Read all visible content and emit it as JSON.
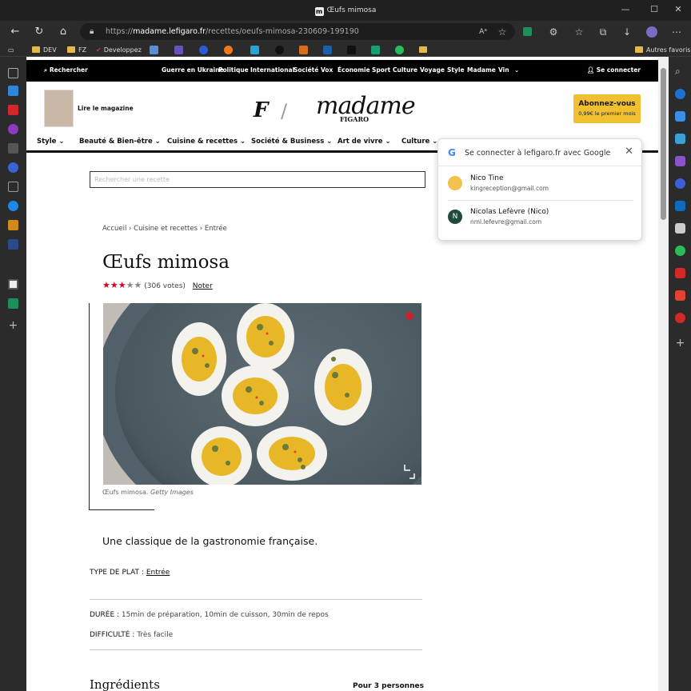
{
  "window": {
    "title": "Œufs mimosa",
    "logo_letter": "m"
  },
  "address": {
    "scheme": "https://",
    "host": "madame.lefigaro.fr",
    "path": "/recettes/oeufs-mimosa-230609-199190"
  },
  "favorites": {
    "items": [
      {
        "label": "DEV"
      },
      {
        "label": "FZ"
      },
      {
        "label": "Developpez"
      }
    ],
    "other_label": "Autres favoris"
  },
  "topnav": {
    "search_label": "Rechercher",
    "items": [
      "Guerre en Ukraine",
      "Politique",
      "International",
      "Société",
      "Vox",
      "Économie",
      "Sport",
      "Culture",
      "Voyage",
      "Style",
      "Madame",
      "Vin"
    ],
    "login_label": "Se connecter"
  },
  "masthead": {
    "magazine_label": "Lire le magazine",
    "logo_f": "F",
    "logo_text": "madame",
    "logo_sub": "FIGARO",
    "subscribe_main": "Abonnez-vous",
    "subscribe_sub": "0,99€ le premier mois"
  },
  "categories": [
    "Style",
    "Beauté & Bien-être",
    "Cuisine & recettes",
    "Société & Business",
    "Art de vivre",
    "Culture"
  ],
  "recipe_search": {
    "placeholder": "Rechercher une recette"
  },
  "breadcrumb": [
    "Accueil",
    "Cuisine et recettes",
    "Entrée"
  ],
  "recipe": {
    "title": "Œufs mimosa",
    "rating": 3,
    "rating_max": 5,
    "votes": "(306 votes)",
    "rate_label": "Noter",
    "caption": "Œufs mimosa.",
    "caption_credit": "Getty Images",
    "tagline": "Une classique de la gastronomie française.",
    "type_label": "TYPE DE PLAT :",
    "type_value": "Entrée",
    "duration_label": "DURÉE :",
    "duration_value": "15min de préparation, 10min de cuisson, 30min de repos",
    "difficulty_label": "DIFFICULTÉ :",
    "difficulty_value": "Très facile",
    "ingredients_title": "Ingrédients",
    "servings": "Pour 3 personnes"
  },
  "google_popup": {
    "title": "Se connecter à lefigaro.fr avec Google",
    "accounts": [
      {
        "name": "Nico Tine",
        "email": "kingreception@gmail.com",
        "avatar_color": "#f2c14e"
      },
      {
        "name": "Nicolas Lefèvre (Nico)",
        "email": "nml.lefevre@gmail.com",
        "avatar_initial": "N",
        "avatar_color": "#1f4b3c"
      }
    ]
  },
  "colors": {
    "star_on": "#d0021b",
    "star_off": "#888888",
    "subscribe": "#f0c030"
  }
}
